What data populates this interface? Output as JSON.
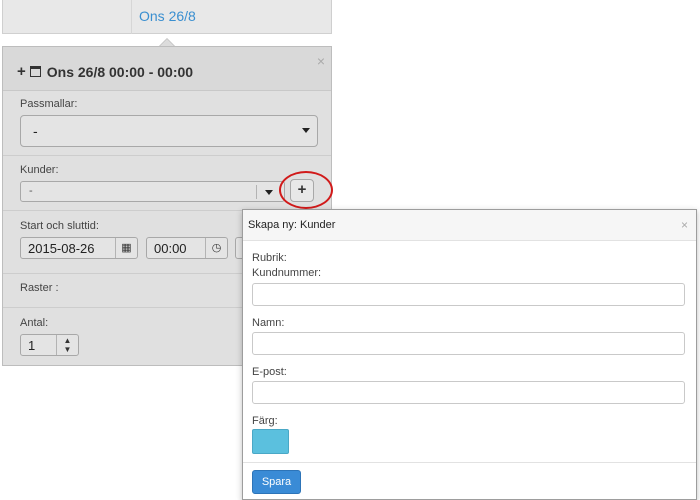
{
  "calendar": {
    "day_label": "Ons 26/8"
  },
  "popover": {
    "title": "Ons 26/8 00:00 - 00:00",
    "close": "×",
    "passmallar": {
      "label": "Passmallar:",
      "value": "-"
    },
    "kunder": {
      "label": "Kunder:",
      "value": "-",
      "add_button": "+"
    },
    "start_slut": {
      "label": "Start och sluttid:",
      "date": "2015-08-26",
      "time": "00:00"
    },
    "raster": {
      "label": "Raster :"
    },
    "antal": {
      "label": "Antal:",
      "value": "1"
    }
  },
  "dialog": {
    "title": "Skapa ny: Kunder",
    "close": "×",
    "rubrik_label": "Rubrik:",
    "fields": [
      {
        "label": "Kundnummer:",
        "value": ""
      },
      {
        "label": "Namn:",
        "value": ""
      },
      {
        "label": "E-post:",
        "value": ""
      }
    ],
    "color_label": "Färg:",
    "color_value": "#5bc0de",
    "save_label": "Spara"
  }
}
